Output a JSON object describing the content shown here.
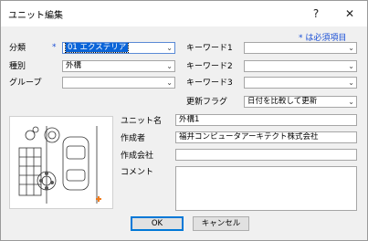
{
  "window": {
    "title": "ユニット編集",
    "help": "?",
    "close": "✕"
  },
  "required_note": "* は必須項目",
  "left": {
    "category": {
      "label": "分類",
      "required_mark": "*",
      "value": "01 エクステリア"
    },
    "kind": {
      "label": "種別",
      "value": "外構"
    },
    "group": {
      "label": "グループ",
      "value": ""
    }
  },
  "right": {
    "keyword1": {
      "label": "キーワード1",
      "value": ""
    },
    "keyword2": {
      "label": "キーワード2",
      "value": ""
    },
    "keyword3": {
      "label": "キーワード3",
      "value": ""
    },
    "update_flag": {
      "label": "更新フラグ",
      "value": "日付を比較して更新"
    }
  },
  "details": {
    "unit_name": {
      "label": "ユニット名",
      "value": "外構1"
    },
    "author": {
      "label": "作成者",
      "value": "福井コンピュータアーキテクト株式会社"
    },
    "company": {
      "label": "作成会社",
      "value": ""
    },
    "comment": {
      "label": "コメント",
      "value": ""
    }
  },
  "buttons": {
    "ok": "OK",
    "cancel": "キャンセル"
  },
  "dropdown_arrow": "⌄"
}
